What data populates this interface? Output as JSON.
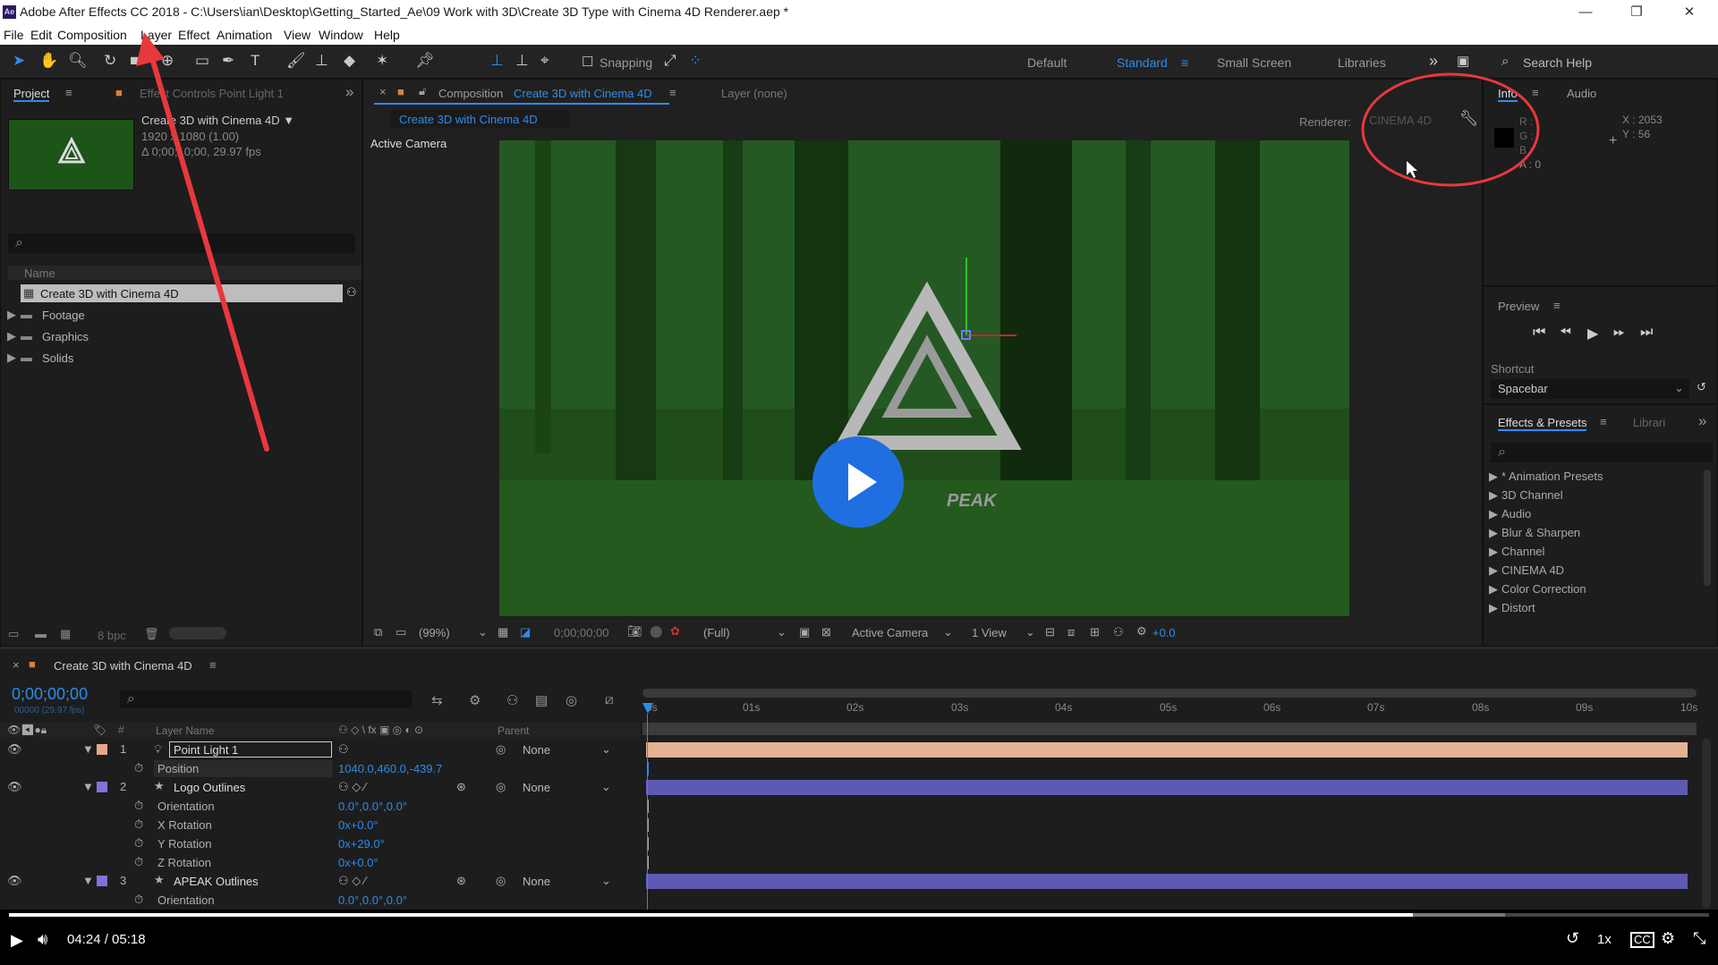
{
  "window": {
    "title": "Adobe After Effects CC 2018 - C:\\Users\\ian\\Desktop\\Getting_Started_Ae\\09 Work with 3D\\Create 3D Type with Cinema 4D Renderer.aep *",
    "app_badge": "Ae",
    "minimize": "—",
    "restore": "❐",
    "close": "✕"
  },
  "menu": [
    "File",
    "Edit",
    "Composition",
    "Layer",
    "Effect",
    "Animation",
    "View",
    "Window",
    "Help"
  ],
  "toolbar": {
    "snapping": "Snapping",
    "workspaces": [
      "Default",
      "Standard",
      "Small Screen",
      "Libraries"
    ],
    "more": "»",
    "search_placeholder": "Search Help"
  },
  "project": {
    "tab": "Project",
    "effect_controls": "Effect Controls Point Light 1",
    "comp_name": "Create 3D with Cinema 4D ▼",
    "comp_size": "1920 x 1080 (1.00)",
    "comp_duration": "Δ 0;00;10;00, 29.97 fps",
    "col_name": "Name",
    "items": [
      {
        "name": "Create 3D with Cinema 4D",
        "type": "comp"
      },
      {
        "name": "Footage",
        "type": "folder"
      },
      {
        "name": "Graphics",
        "type": "folder"
      },
      {
        "name": "Solids",
        "type": "folder"
      }
    ],
    "bpc": "8 bpc"
  },
  "comp": {
    "tab_prefix": "Composition",
    "tab_name": "Create 3D with Cinema 4D",
    "layer_tab": "Layer (none)",
    "subtab": "Create 3D with Cinema 4D",
    "renderer_label": "Renderer:",
    "renderer": "CINEMA 4D",
    "view_label": "Active Camera",
    "logo_text": "PEAK",
    "zoom": "(99%)",
    "time": "0;00;00;00",
    "resolution": "(Full)",
    "camera": "Active Camera",
    "views": "1 View",
    "exposure": "+0.0"
  },
  "info": {
    "tab": "Info",
    "audio_tab": "Audio",
    "r": "R :",
    "g": "G :",
    "b": "B :",
    "a": "A : 0",
    "x": "X : 2053",
    "y": "Y : 56"
  },
  "preview": {
    "tab": "Preview",
    "shortcut_label": "Shortcut",
    "shortcut": "Spacebar"
  },
  "effects": {
    "tab": "Effects & Presets",
    "libraries_tab": "Librari",
    "items": [
      "* Animation Presets",
      "3D Channel",
      "Audio",
      "Blur & Sharpen",
      "Channel",
      "CINEMA 4D",
      "Color Correction",
      "Distort"
    ]
  },
  "timeline": {
    "tab": "Create 3D with Cinema 4D",
    "timecode": "0;00;00;00",
    "frame_info": "00000 (29.97 fps)",
    "col_layer": "Layer Name",
    "col_parent": "Parent",
    "col_num": "#",
    "ticks": [
      "0s",
      "01s",
      "02s",
      "03s",
      "04s",
      "05s",
      "06s",
      "07s",
      "08s",
      "09s",
      "10s"
    ],
    "rows": [
      {
        "kind": "layer",
        "num": "1",
        "name": "Point Light 1",
        "parent": "None",
        "color": "#e7a88a",
        "bar": "#e4b394"
      },
      {
        "kind": "prop",
        "name": "Position",
        "value": "1040.0,460.0,-439.7"
      },
      {
        "kind": "layer",
        "num": "2",
        "name": "Logo Outlines",
        "parent": "None",
        "color": "#7f74d8",
        "bar": "#5e5ab3"
      },
      {
        "kind": "prop",
        "name": "Orientation",
        "value": "0.0°,0.0°,0.0°"
      },
      {
        "kind": "prop",
        "name": "X Rotation",
        "value": "0x+0.0°"
      },
      {
        "kind": "prop",
        "name": "Y Rotation",
        "value": "0x+29.0°"
      },
      {
        "kind": "prop",
        "name": "Z Rotation",
        "value": "0x+0.0°"
      },
      {
        "kind": "layer",
        "num": "3",
        "name": "APEAK Outlines",
        "parent": "None",
        "color": "#7f74d8",
        "bar": "#5e5ab3"
      },
      {
        "kind": "prop",
        "name": "Orientation",
        "value": "0.0°,0.0°,0.0°"
      }
    ]
  },
  "video": {
    "current": "04:24",
    "duration": "05:18",
    "time_display": "04:24 / 05:18",
    "progress": 0.826,
    "buffered": 0.88,
    "speed": "1x",
    "cc": "CC"
  },
  "colors": {
    "accent": "#2d8ceb",
    "annotation": "#e8383d",
    "play_button": "#1f6fe0"
  }
}
